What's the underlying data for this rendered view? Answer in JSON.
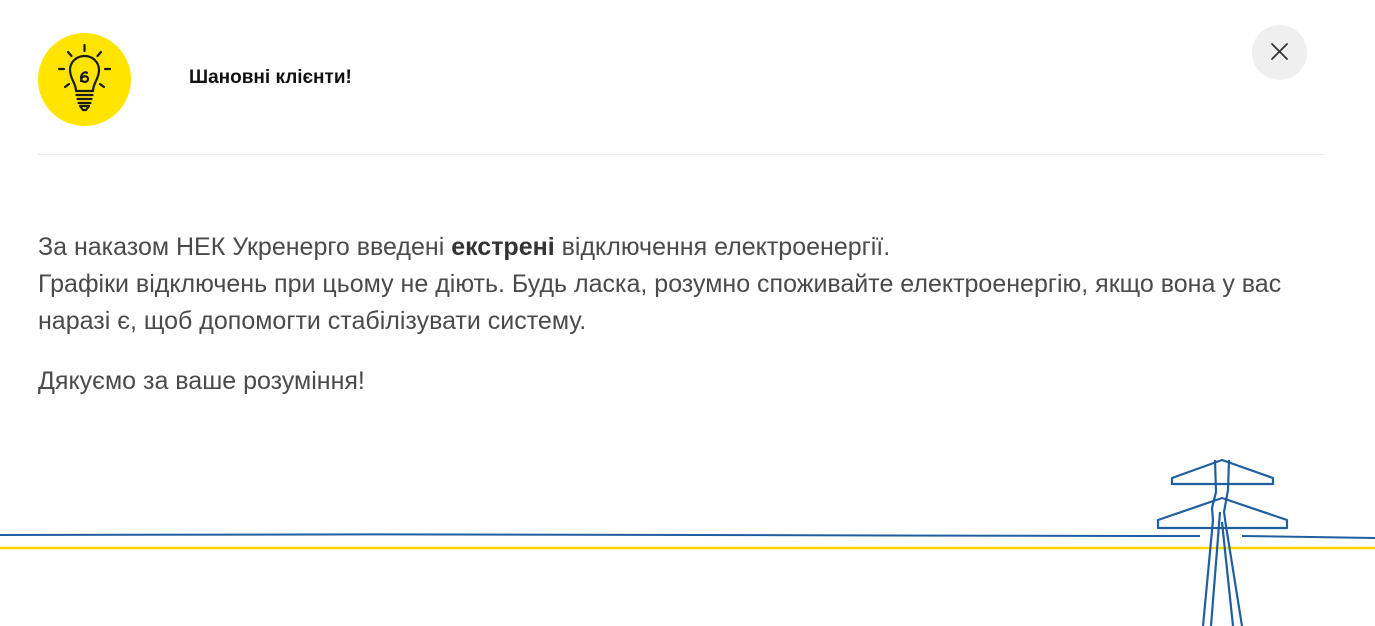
{
  "header": {
    "title": "Шановні клієнти!",
    "icon": "lightbulb-icon",
    "icon_bg_color": "#ffe400",
    "close_icon": "close-icon"
  },
  "message": {
    "line1_before": "За наказом НЕК Укренерго введені ",
    "line1_bold": "екстрені",
    "line1_after": " відключення електроенергії.",
    "line2": "Графіки відключень при цьому не діють.  Будь ласка, розумно споживайте електроенергію, якщо вона у вас наразі є, щоб допомогти стабілізувати систему.",
    "thanks": "Дякуємо за ваше розуміння!"
  },
  "decoration": {
    "icon": "power-tower-icon",
    "line_blue": "#1f5fa0",
    "line_yellow": "#ffd500"
  }
}
